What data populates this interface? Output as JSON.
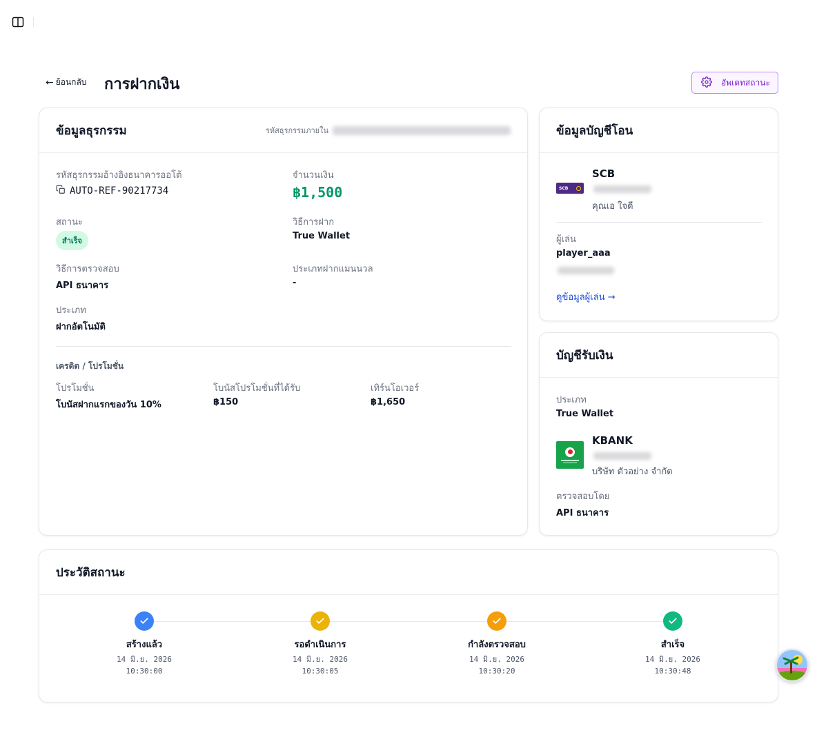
{
  "header": {
    "back_label": "ย้อนกลับ",
    "title": "การฝากเงิน",
    "update_button": "อัพเดทสถานะ"
  },
  "transaction": {
    "title": "ข้อมูลธุรกรรม",
    "internal_id_label": "รหัสธุรกรรมภายใน",
    "ref_label": "รหัสธุรกรรมอ้างอิงธนาคารออโต้",
    "ref_value": "AUTO-REF-90217734",
    "amount_label": "จำนวนเงิน",
    "amount_value": "฿1,500",
    "status_label": "สถานะ",
    "status_value": "สำเร็จ",
    "method_label": "วิธีการฝาก",
    "method_value": "True Wallet",
    "verify_label": "วิธีการตรวจสอบ",
    "verify_value": "API ธนาคาร",
    "manual_type_label": "ประเภทฝากแมนนวล",
    "manual_type_value": "-",
    "type_label": "ประเภท",
    "type_value": "ฝากอัตโนมัติ",
    "credit_section": "เครดิต / โปรโมชั่น",
    "promo_label": "โปรโมชั่น",
    "promo_value": "โบนัสฝากแรกของวัน 10%",
    "bonus_label": "โบนัสโปรโมชั่นที่ได้รับ",
    "bonus_value": "฿150",
    "turnover_label": "เทิร์นโอเวอร์",
    "turnover_value": "฿1,650"
  },
  "sender": {
    "title": "ข้อมูลบัญชีโอน",
    "bank_code": "SCB",
    "bank_logo_text": "SCB",
    "account_name": "คุณเอ ใจดี",
    "player_label": "ผู้เล่น",
    "player_value": "player_aaa",
    "view_player_link": "ดูข้อมูลผู้เล่น →"
  },
  "receiver": {
    "title": "บัญชีรับเงิน",
    "type_label": "ประเภท",
    "type_value": "True Wallet",
    "bank_code": "KBANK",
    "account_name": "บริษัท ตัวอย่าง จำกัด",
    "verified_by_label": "ตรวจสอบโดย",
    "verified_by_value": "API ธนาคาร"
  },
  "history": {
    "title": "ประวัติสถานะ",
    "steps": [
      {
        "label": "สร้างแล้ว",
        "date": "14 มิ.ย. 2026",
        "time": "10:30:00",
        "color": "#3b82f6"
      },
      {
        "label": "รอดำเนินการ",
        "date": "14 มิ.ย. 2026",
        "time": "10:30:05",
        "color": "#eab308"
      },
      {
        "label": "กำลังตรวจสอบ",
        "date": "14 มิ.ย. 2026",
        "time": "10:30:20",
        "color": "#f59e0b"
      },
      {
        "label": "สำเร็จ",
        "date": "14 มิ.ย. 2026",
        "time": "10:30:48",
        "color": "#10b981"
      }
    ]
  },
  "colors": {
    "amount_green": "#059669",
    "accent_purple": "#7e22ce",
    "scb_purple": "#4e2a84",
    "kbank_green": "#16a34a",
    "link_blue": "#1d4ed8"
  }
}
